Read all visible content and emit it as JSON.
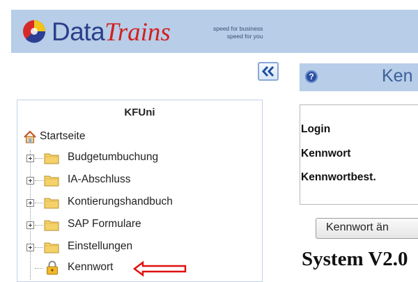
{
  "header": {
    "brand_part1": "Data",
    "brand_part2": "Trains",
    "tagline_line1": "speed for business",
    "tagline_line2": "speed for you"
  },
  "sidebar": {
    "collapse_label": "«",
    "title": "KFUni",
    "home": {
      "label": "Startseite",
      "icon": "home-icon"
    },
    "items": [
      {
        "label": "Budgetumbuchung",
        "icon": "folder-icon",
        "expandable": true
      },
      {
        "label": "IA-Abschluss",
        "icon": "folder-icon",
        "expandable": true
      },
      {
        "label": "Kontierungshandbuch",
        "icon": "folder-icon",
        "expandable": true
      },
      {
        "label": "SAP Formulare",
        "icon": "folder-icon",
        "expandable": true
      },
      {
        "label": "Einstellungen",
        "icon": "folder-icon",
        "expandable": true
      },
      {
        "label": "Kennwort",
        "icon": "lock-icon",
        "expandable": false,
        "highlighted": true
      }
    ]
  },
  "content": {
    "help_label": "?",
    "title": "Ken",
    "fields": [
      {
        "label": "Login"
      },
      {
        "label": "Kennwort"
      },
      {
        "label": "Kennwortbest."
      }
    ],
    "submit_label": "Kennwort än",
    "system_version": "System V2.0"
  },
  "colors": {
    "header_bg": "#b7cde8",
    "brand_blue": "#2b3f8a",
    "brand_red": "#d22020",
    "folder_yellow": "#f5d16a",
    "arrow_red": "#e01010"
  }
}
